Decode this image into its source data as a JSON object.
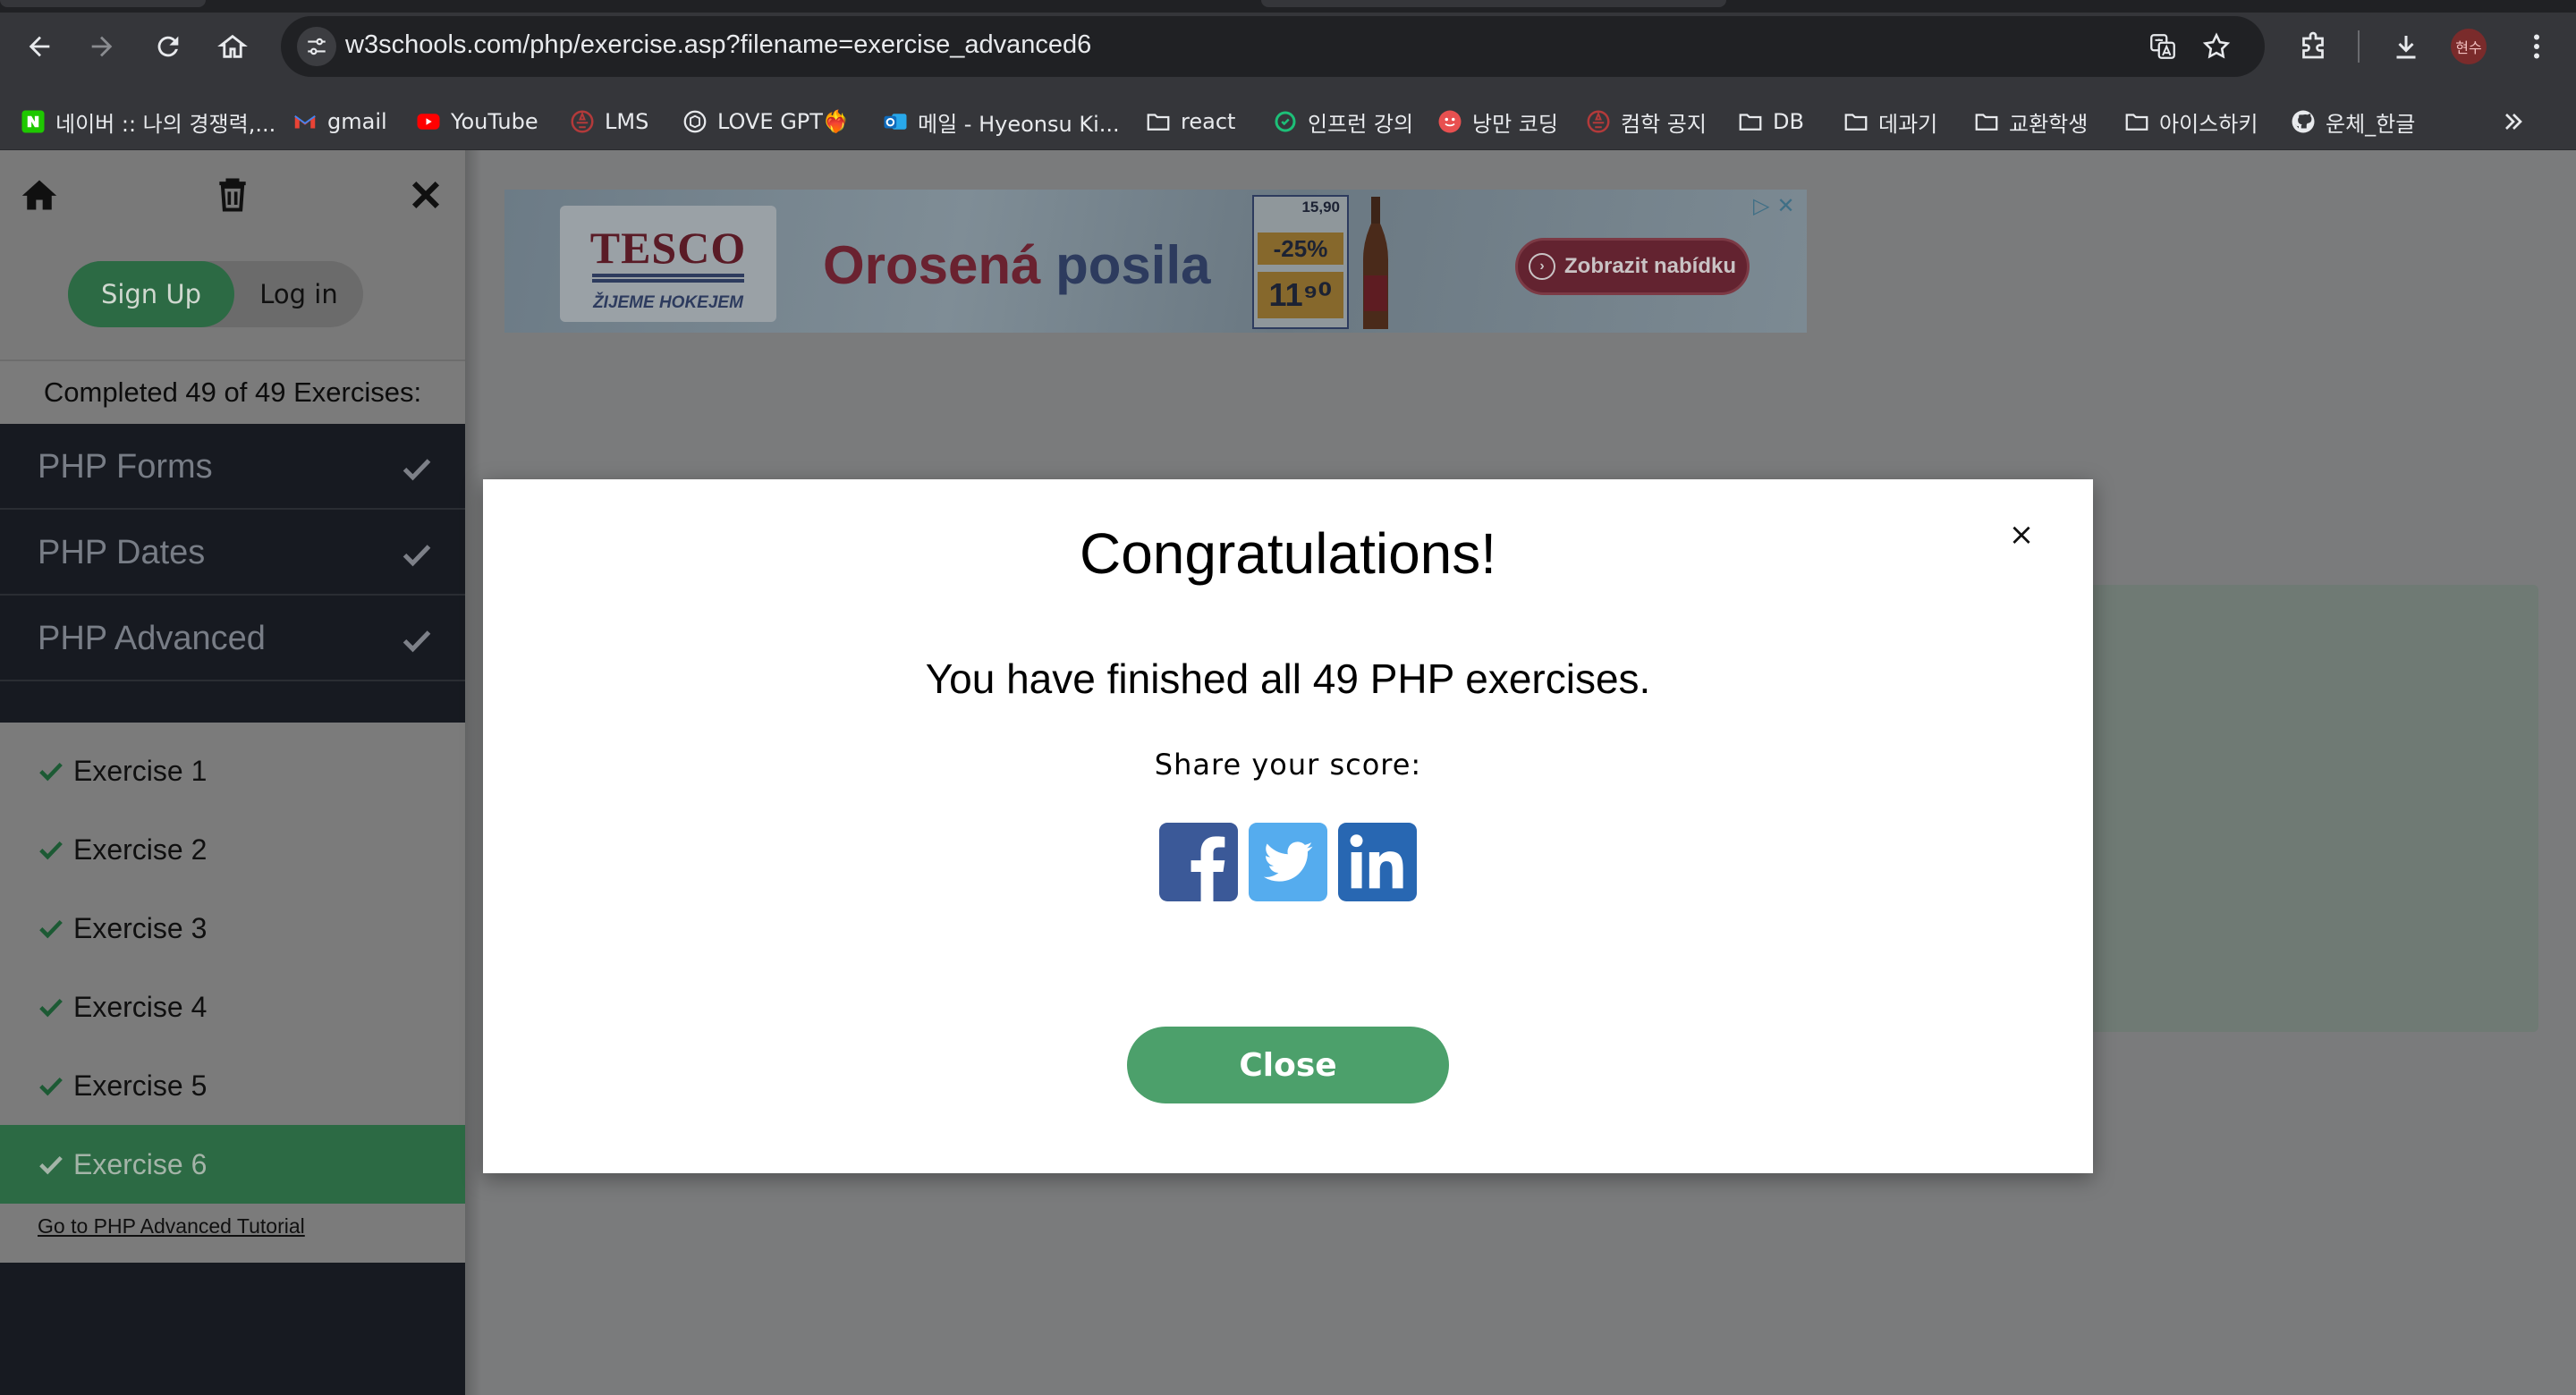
{
  "browser": {
    "url_host": "w3schools.com",
    "url_path": "/php/exercise.asp?filename=exercise_advanced6",
    "profile_initials": "현수",
    "bookmarks": [
      {
        "label": "네이버 :: 나의 경쟁력,...",
        "icon": "naver-icon",
        "color": "#1ec800"
      },
      {
        "label": "gmail",
        "icon": "gmail-icon",
        "color": "#ea4335"
      },
      {
        "label": "YouTube",
        "icon": "youtube-icon",
        "color": "#ff0000"
      },
      {
        "label": "LMS",
        "icon": "lms-icon",
        "color": "#b33a3a"
      },
      {
        "label": "LOVE GPT❤️‍🔥",
        "icon": "chatgpt-icon",
        "color": "#e8eaed"
      },
      {
        "label": "메일 - Hyeonsu Ki...",
        "icon": "outlook-icon",
        "color": "#0f6cbd"
      },
      {
        "label": "react",
        "icon": "folder-icon",
        "color": "#e8eaed"
      },
      {
        "label": "인프런 강의",
        "icon": "inflearn-icon",
        "color": "#1dc078"
      },
      {
        "label": "낭만 코딩",
        "icon": "romantic-coding-icon",
        "color": "#e85050"
      },
      {
        "label": "컴학 공지",
        "icon": "notice-icon",
        "color": "#b33a3a"
      },
      {
        "label": "DB",
        "icon": "folder-icon",
        "color": "#e8eaed"
      },
      {
        "label": "데과기",
        "icon": "folder-icon",
        "color": "#e8eaed"
      },
      {
        "label": "교환학생",
        "icon": "folder-icon",
        "color": "#e8eaed"
      },
      {
        "label": "아이스하키",
        "icon": "folder-icon",
        "color": "#e8eaed"
      },
      {
        "label": "운체_한글",
        "icon": "github-icon",
        "color": "#e8eaed"
      }
    ]
  },
  "sidebar": {
    "signup_label": "Sign Up",
    "login_label": "Log in",
    "progress_text": "Completed 49 of 49 Exercises:",
    "chapters": [
      {
        "label": "PHP Forms",
        "completed": true
      },
      {
        "label": "PHP Dates",
        "completed": true
      },
      {
        "label": "PHP Advanced",
        "completed": true
      }
    ],
    "exercises": [
      {
        "label": "Exercise 1",
        "completed": true,
        "active": false
      },
      {
        "label": "Exercise 2",
        "completed": true,
        "active": false
      },
      {
        "label": "Exercise 3",
        "completed": true,
        "active": false
      },
      {
        "label": "Exercise 4",
        "completed": true,
        "active": false
      },
      {
        "label": "Exercise 5",
        "completed": true,
        "active": false
      },
      {
        "label": "Exercise 6",
        "completed": true,
        "active": true
      }
    ],
    "tutorial_link": "Go to PHP Advanced Tutorial"
  },
  "ad": {
    "brand": "TESCO",
    "brand_tagline": "ŽIJEME HOKEJEM",
    "headline_part1": "Orosená",
    "headline_part2": "posila",
    "price_old": "15,90",
    "discount": "-25%",
    "price_new": "11⁹⁰",
    "cta": "Zobrazit nabídku"
  },
  "modal": {
    "title": "Congratulations!",
    "message": "You have finished all 49 PHP exercises.",
    "share_label": "Share your score:",
    "share_targets": [
      "facebook-icon",
      "twitter-icon",
      "linkedin-icon"
    ],
    "close_button": "Close",
    "close_x": "×"
  },
  "colors": {
    "w3_green": "#04aa6d",
    "modal_close_green": "#4ca06b",
    "facebook": "#3b5998",
    "twitter": "#55acee",
    "linkedin": "#0e76a8"
  }
}
